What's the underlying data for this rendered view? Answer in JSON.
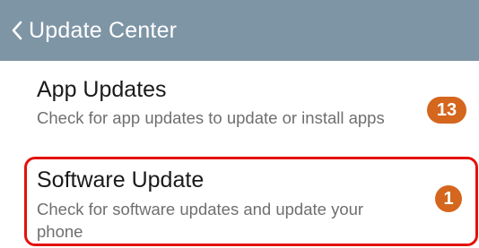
{
  "header": {
    "back_icon": "chevron-left-icon",
    "title": "Update Center"
  },
  "items": [
    {
      "label": "App Updates",
      "description": "Check for app updates to update or install apps",
      "badge": "13"
    },
    {
      "label": "Software Update",
      "description": "Check for software updates and update your phone",
      "badge": "1"
    }
  ],
  "colors": {
    "header_bg": "#7e95a5",
    "badge": "#d4661d",
    "highlight": "#e3120b"
  }
}
